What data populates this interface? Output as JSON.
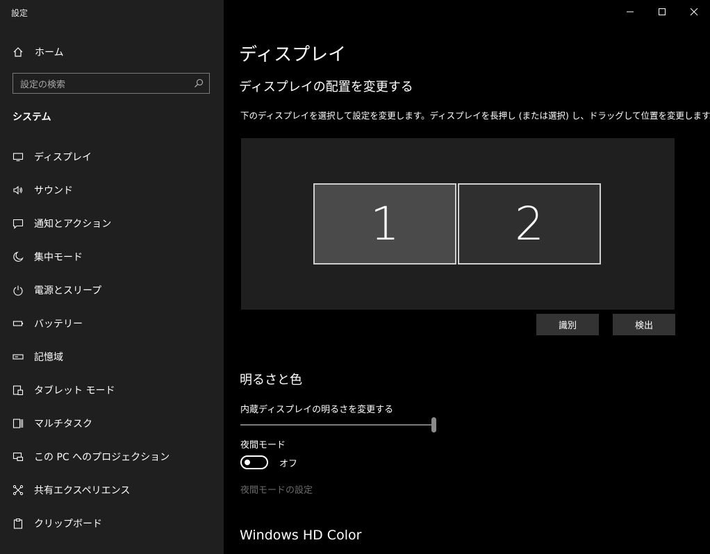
{
  "window": {
    "title": "設定"
  },
  "sidebar": {
    "home_label": "ホーム",
    "search_placeholder": "設定の検索",
    "category": "システム",
    "items": [
      {
        "label": "ディスプレイ",
        "icon": "monitor-icon"
      },
      {
        "label": "サウンド",
        "icon": "speaker-icon"
      },
      {
        "label": "通知とアクション",
        "icon": "notification-icon"
      },
      {
        "label": "集中モード",
        "icon": "moon-icon"
      },
      {
        "label": "電源とスリープ",
        "icon": "power-icon"
      },
      {
        "label": "バッテリー",
        "icon": "battery-icon"
      },
      {
        "label": "記憶域",
        "icon": "storage-icon"
      },
      {
        "label": "タブレット モード",
        "icon": "tablet-icon"
      },
      {
        "label": "マルチタスク",
        "icon": "multitask-icon"
      },
      {
        "label": "この PC へのプロジェクション",
        "icon": "projection-icon"
      },
      {
        "label": "共有エクスペリエンス",
        "icon": "shared-experience-icon"
      },
      {
        "label": "クリップボード",
        "icon": "clipboard-icon"
      }
    ]
  },
  "main": {
    "title": "ディスプレイ",
    "arrange_heading": "ディスプレイの配置を変更する",
    "arrange_desc": "下のディスプレイを選択して設定を変更します。ディスプレイを長押し (または選択) し、ドラッグして位置を変更します。",
    "monitors": [
      "1",
      "2"
    ],
    "identify_label": "識別",
    "detect_label": "検出",
    "brightness_heading": "明るさと色",
    "brightness_label": "内蔵ディスプレイの明るさを変更する",
    "brightness_value": 100,
    "night_label": "夜間モード",
    "night_state": "オフ",
    "night_settings_link": "夜間モードの設定",
    "hd_heading": "Windows HD Color"
  },
  "colors": {
    "sidebar_bg": "#1f1f1f",
    "main_bg": "#000000",
    "monitor_selected": "#4a4a4a",
    "monitor_other": "#2f2f2f",
    "button_bg": "#333333",
    "disabled_text": "#6b6b6b"
  }
}
